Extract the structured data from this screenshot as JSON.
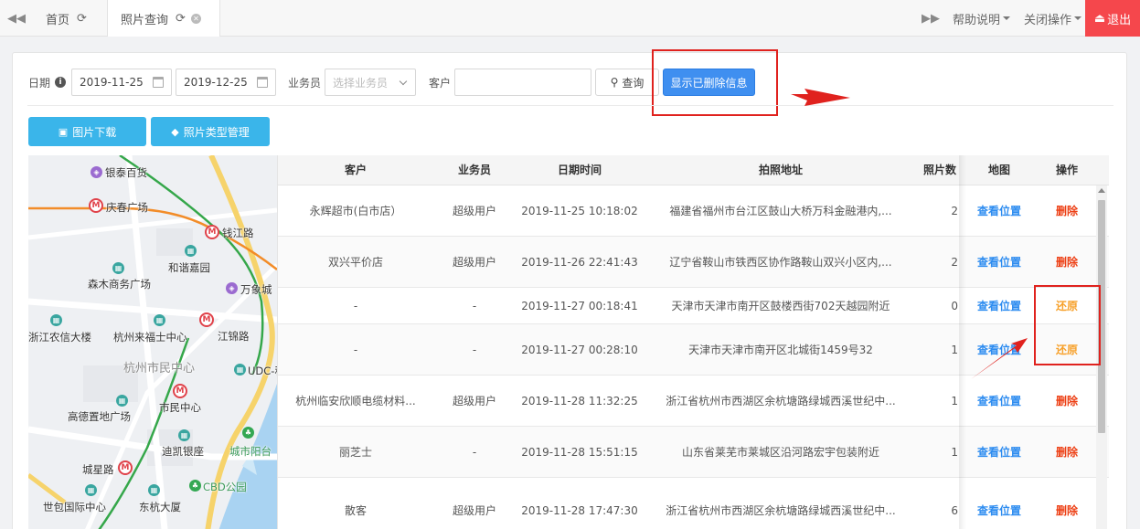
{
  "topbar": {
    "tabs": [
      {
        "label": "首页"
      },
      {
        "label": "照片查询"
      }
    ],
    "help": "帮助说明",
    "close_ops": "关闭操作",
    "logout": "退出"
  },
  "filters": {
    "date_label": "日期",
    "date_start": "2019-11-25",
    "date_end": "2019-12-25",
    "salesman_label": "业务员",
    "salesman_placeholder": "选择业务员",
    "customer_label": "客户",
    "customer_value": "",
    "search_label": "查询",
    "show_deleted_label": "显示已删除信息"
  },
  "actions": {
    "download_label": "图片下载",
    "type_manage_label": "照片类型管理"
  },
  "map": {
    "labels": [
      "银泰百货",
      "庆春广场",
      "钱江路",
      "和谐嘉园",
      "森木商务广场",
      "万象城",
      "浙江农信大楼",
      "杭州来福士中心",
      "江锦路",
      "杭州市民中心",
      "UDC-科",
      "市民中心",
      "高德置地广场",
      "迪凯银座",
      "城市阳台",
      "城星路",
      "CBD公园",
      "世包国际中心",
      "东杭大厦"
    ]
  },
  "table": {
    "columns": [
      "客户",
      "业务员",
      "日期时间",
      "拍照地址",
      "照片数",
      "地图",
      "操作"
    ],
    "rows": [
      {
        "customer": "永辉超市(白市店）",
        "salesman": "超级用户",
        "datetime": "2019-11-25 10:18:02",
        "address": "福建省福州市台江区鼓山大桥万科金融港内,...",
        "count": "2",
        "map": "查看位置",
        "op": "删除",
        "op_type": "delete"
      },
      {
        "customer": "双兴平价店",
        "salesman": "超级用户",
        "datetime": "2019-11-26 22:41:43",
        "address": "辽宁省鞍山市铁西区协作路鞍山双兴小区内,...",
        "count": "2",
        "map": "查看位置",
        "op": "删除",
        "op_type": "delete"
      },
      {
        "customer": "-",
        "salesman": "-",
        "datetime": "2019-11-27 00:18:41",
        "address": "天津市天津市南开区鼓楼西街702天越园附近",
        "count": "0",
        "map": "查看位置",
        "op": "还原",
        "op_type": "restore"
      },
      {
        "customer": "-",
        "salesman": "-",
        "datetime": "2019-11-27 00:28:10",
        "address": "天津市天津市南开区北城街1459号32",
        "count": "1",
        "map": "查看位置",
        "op": "还原",
        "op_type": "restore"
      },
      {
        "customer": "杭州临安欣顺电缆材料...",
        "salesman": "超级用户",
        "datetime": "2019-11-28 11:32:25",
        "address": "浙江省杭州市西湖区余杭塘路绿城西溪世纪中...",
        "count": "1",
        "map": "查看位置",
        "op": "删除",
        "op_type": "delete"
      },
      {
        "customer": "丽芝士",
        "salesman": "-",
        "datetime": "2019-11-28 15:51:15",
        "address": "山东省莱芜市莱城区沿河路宏宇包装附近",
        "count": "1",
        "map": "查看位置",
        "op": "删除",
        "op_type": "delete"
      },
      {
        "customer": "散客",
        "salesman": "超级用户",
        "datetime": "2019-11-28 17:47:30",
        "address": "浙江省杭州市西湖区余杭塘路绿城西溪世纪中...",
        "count": "6",
        "map": "查看位置",
        "op": "删除",
        "op_type": "delete"
      }
    ]
  },
  "colors": {
    "primary": "#3f8ff0",
    "cyan": "#3ab5ea",
    "logout": "#f5474c",
    "link": "#2d8cf0",
    "delete": "#ed3f14",
    "restore": "#f7a12b",
    "annotation": "#e0221e"
  }
}
